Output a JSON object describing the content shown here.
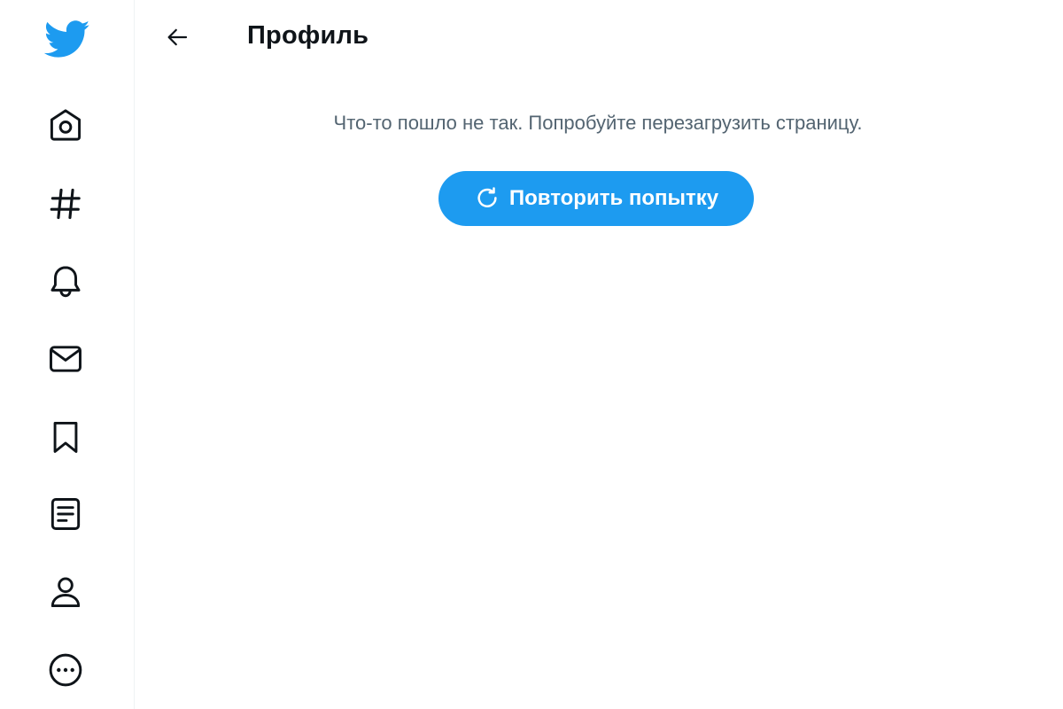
{
  "header": {
    "title": "Профиль"
  },
  "error": {
    "message": "Что-то пошло не так. Попробуйте перезагрузить страницу.",
    "retry_label": "Повторить попытку"
  },
  "sidebar": {
    "items": [
      {
        "icon": "home-icon"
      },
      {
        "icon": "explore-hashtag-icon"
      },
      {
        "icon": "notifications-bell-icon"
      },
      {
        "icon": "messages-envelope-icon"
      },
      {
        "icon": "bookmark-icon"
      },
      {
        "icon": "lists-icon"
      },
      {
        "icon": "profile-icon"
      },
      {
        "icon": "more-icon"
      }
    ]
  },
  "colors": {
    "brand": "#1d9bf0",
    "text_primary": "#0f1419",
    "text_secondary": "#536471"
  }
}
